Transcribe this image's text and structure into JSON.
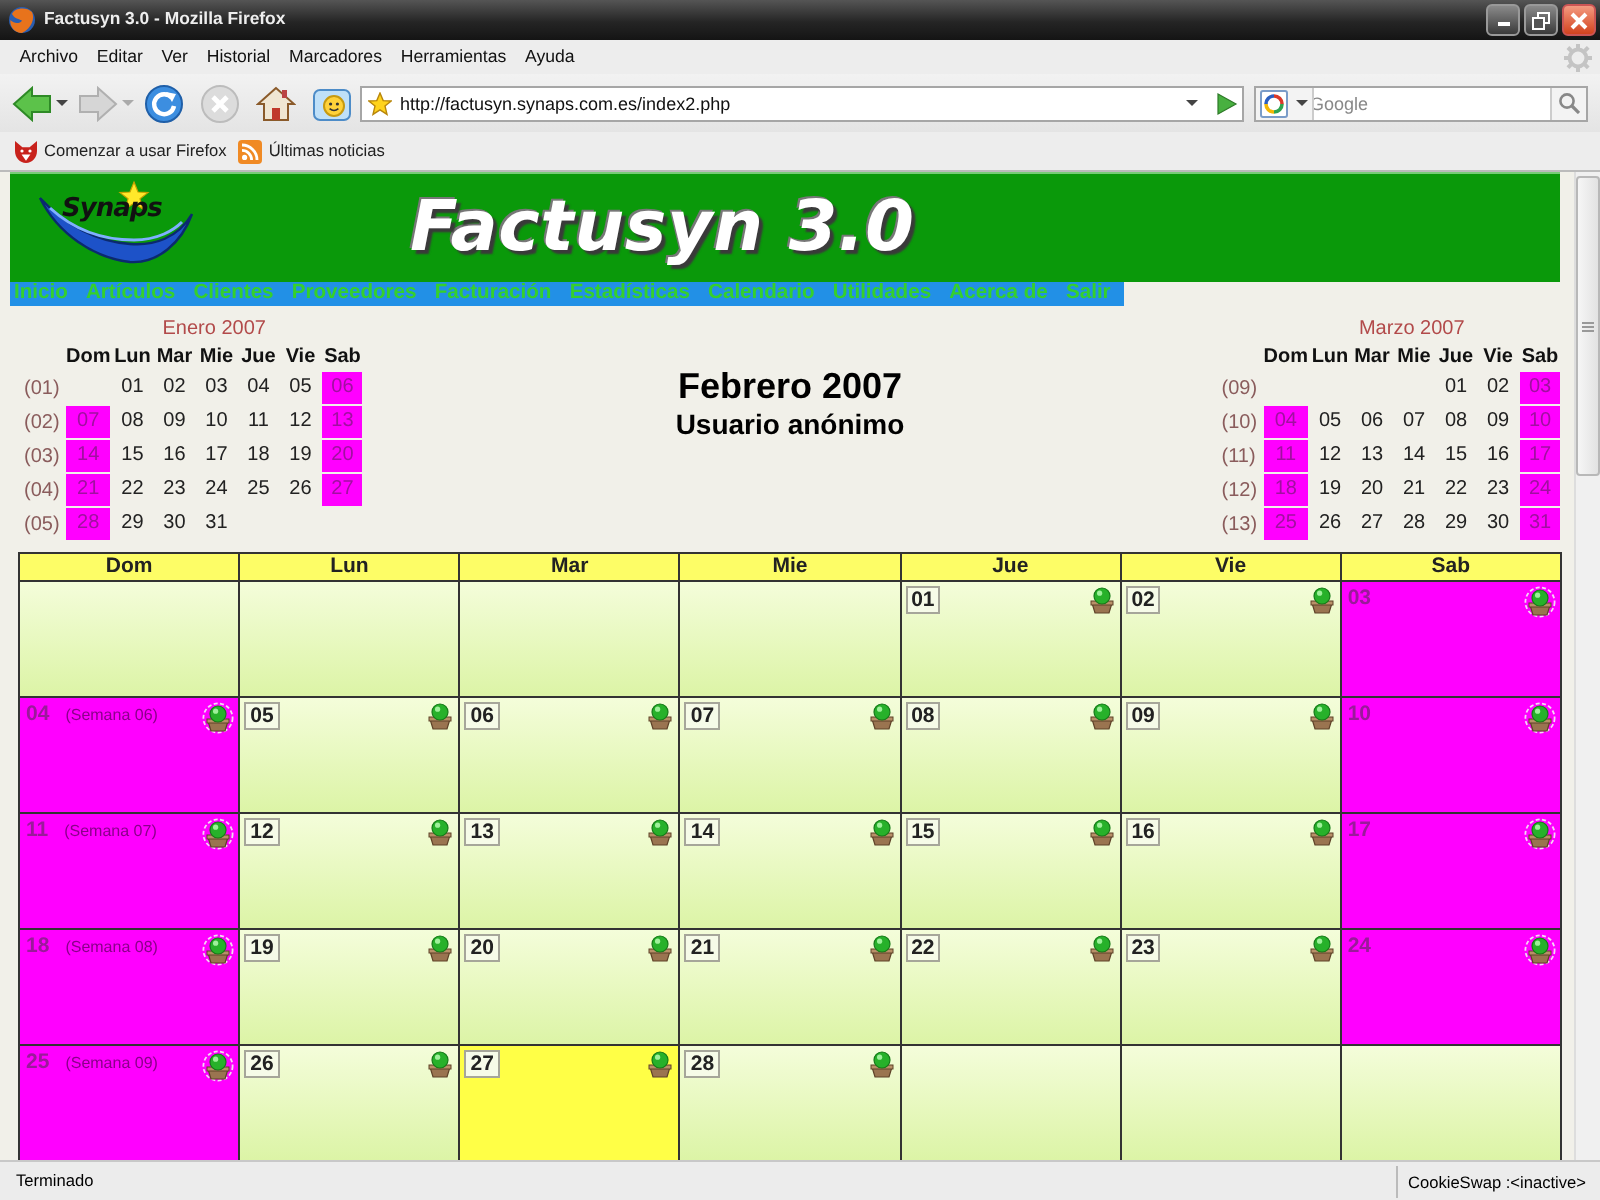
{
  "window": {
    "title": "Factusyn 3.0 - Mozilla Firefox"
  },
  "menu": [
    "Archivo",
    "Editar",
    "Ver",
    "Historial",
    "Marcadores",
    "Herramientas",
    "Ayuda"
  ],
  "address_bar": {
    "url": "http://factusyn.synaps.com.es/index2.php"
  },
  "search_box": {
    "placeholder": "Google"
  },
  "bookmarks": [
    {
      "kind": "bookmark",
      "label": "Comenzar a usar Firefox"
    },
    {
      "kind": "feed",
      "label": "Últimas noticias"
    }
  ],
  "banner": {
    "logo": "Synaps",
    "title": "Factusyn 3.0"
  },
  "nav": [
    "Inicio",
    "Artículos",
    "Clientes",
    "Proveedores",
    "Facturación",
    "Estadísticas",
    "Calendario",
    "Utilidades",
    "Acerca de",
    "Salir"
  ],
  "header": {
    "prev_month": {
      "title": "Enero 2007",
      "weekdays": [
        "Dom",
        "Lun",
        "Mar",
        "Mie",
        "Jue",
        "Vie",
        "Sab"
      ],
      "weeks": [
        {
          "number": "(01)",
          "days": [
            {
              "kind": "blank"
            },
            {
              "kind": "weekday",
              "day": "01"
            },
            {
              "kind": "weekday",
              "day": "02"
            },
            {
              "kind": "weekday",
              "day": "03"
            },
            {
              "kind": "weekday",
              "day": "04"
            },
            {
              "kind": "weekday",
              "day": "05"
            },
            {
              "kind": "weekend",
              "day": "06"
            }
          ]
        },
        {
          "number": "(02)",
          "days": [
            {
              "kind": "weekend",
              "day": "07"
            },
            {
              "kind": "weekday",
              "day": "08"
            },
            {
              "kind": "weekday",
              "day": "09"
            },
            {
              "kind": "weekday",
              "day": "10"
            },
            {
              "kind": "weekday",
              "day": "11"
            },
            {
              "kind": "weekday",
              "day": "12"
            },
            {
              "kind": "weekend",
              "day": "13"
            }
          ]
        },
        {
          "number": "(03)",
          "days": [
            {
              "kind": "weekend",
              "day": "14"
            },
            {
              "kind": "weekday",
              "day": "15"
            },
            {
              "kind": "weekday",
              "day": "16"
            },
            {
              "kind": "weekday",
              "day": "17"
            },
            {
              "kind": "weekday",
              "day": "18"
            },
            {
              "kind": "weekday",
              "day": "19"
            },
            {
              "kind": "weekend",
              "day": "20"
            }
          ]
        },
        {
          "number": "(04)",
          "days": [
            {
              "kind": "weekend",
              "day": "21"
            },
            {
              "kind": "weekday",
              "day": "22"
            },
            {
              "kind": "weekday",
              "day": "23"
            },
            {
              "kind": "weekday",
              "day": "24"
            },
            {
              "kind": "weekday",
              "day": "25"
            },
            {
              "kind": "weekday",
              "day": "26"
            },
            {
              "kind": "weekend",
              "day": "27"
            }
          ]
        },
        {
          "number": "(05)",
          "days": [
            {
              "kind": "weekend",
              "day": "28"
            },
            {
              "kind": "weekday",
              "day": "29"
            },
            {
              "kind": "weekday",
              "day": "30"
            },
            {
              "kind": "weekday",
              "day": "31"
            },
            {
              "kind": "blank"
            },
            {
              "kind": "blank"
            },
            {
              "kind": "blank"
            }
          ]
        }
      ]
    },
    "title": "Febrero 2007",
    "user": "Usuario anónimo",
    "next_month": {
      "title": "Marzo 2007",
      "weekdays": [
        "Dom",
        "Lun",
        "Mar",
        "Mie",
        "Jue",
        "Vie",
        "Sab"
      ],
      "weeks": [
        {
          "number": "(09)",
          "days": [
            {
              "kind": "blank"
            },
            {
              "kind": "blank"
            },
            {
              "kind": "blank"
            },
            {
              "kind": "blank"
            },
            {
              "kind": "weekday",
              "day": "01"
            },
            {
              "kind": "weekday",
              "day": "02"
            },
            {
              "kind": "weekend",
              "day": "03"
            }
          ]
        },
        {
          "number": "(10)",
          "days": [
            {
              "kind": "weekend",
              "day": "04"
            },
            {
              "kind": "weekday",
              "day": "05"
            },
            {
              "kind": "weekday",
              "day": "06"
            },
            {
              "kind": "weekday",
              "day": "07"
            },
            {
              "kind": "weekday",
              "day": "08"
            },
            {
              "kind": "weekday",
              "day": "09"
            },
            {
              "kind": "weekend",
              "day": "10"
            }
          ]
        },
        {
          "number": "(11)",
          "days": [
            {
              "kind": "weekend",
              "day": "11"
            },
            {
              "kind": "weekday",
              "day": "12"
            },
            {
              "kind": "weekday",
              "day": "13"
            },
            {
              "kind": "weekday",
              "day": "14"
            },
            {
              "kind": "weekday",
              "day": "15"
            },
            {
              "kind": "weekday",
              "day": "16"
            },
            {
              "kind": "weekend",
              "day": "17"
            }
          ]
        },
        {
          "number": "(12)",
          "days": [
            {
              "kind": "weekend",
              "day": "18"
            },
            {
              "kind": "weekday",
              "day": "19"
            },
            {
              "kind": "weekday",
              "day": "20"
            },
            {
              "kind": "weekday",
              "day": "21"
            },
            {
              "kind": "weekday",
              "day": "22"
            },
            {
              "kind": "weekday",
              "day": "23"
            },
            {
              "kind": "weekend",
              "day": "24"
            }
          ]
        },
        {
          "number": "(13)",
          "days": [
            {
              "kind": "weekend",
              "day": "25"
            },
            {
              "kind": "weekday",
              "day": "26"
            },
            {
              "kind": "weekday",
              "day": "27"
            },
            {
              "kind": "weekday",
              "day": "28"
            },
            {
              "kind": "weekday",
              "day": "29"
            },
            {
              "kind": "weekday",
              "day": "30"
            },
            {
              "kind": "weekend",
              "day": "31"
            }
          ]
        }
      ]
    }
  },
  "calendar": {
    "columns": [
      "Dom",
      "Lun",
      "Mar",
      "Mie",
      "Jue",
      "Vie",
      "Sab"
    ],
    "weeks": [
      {
        "days": [
          {
            "kind": "blank"
          },
          {
            "kind": "blank"
          },
          {
            "kind": "blank"
          },
          {
            "kind": "blank"
          },
          {
            "kind": "weekday",
            "day": "01"
          },
          {
            "kind": "weekday",
            "day": "02"
          },
          {
            "kind": "weekend",
            "day": "03"
          }
        ]
      },
      {
        "days": [
          {
            "kind": "weekend",
            "day": "04",
            "week_label": "(Semana 06)"
          },
          {
            "kind": "weekday",
            "day": "05"
          },
          {
            "kind": "weekday",
            "day": "06"
          },
          {
            "kind": "weekday",
            "day": "07"
          },
          {
            "kind": "weekday",
            "day": "08"
          },
          {
            "kind": "weekday",
            "day": "09"
          },
          {
            "kind": "weekend",
            "day": "10"
          }
        ]
      },
      {
        "days": [
          {
            "kind": "weekend",
            "day": "11",
            "week_label": "(Semana 07)"
          },
          {
            "kind": "weekday",
            "day": "12"
          },
          {
            "kind": "weekday",
            "day": "13"
          },
          {
            "kind": "weekday",
            "day": "14"
          },
          {
            "kind": "weekday",
            "day": "15"
          },
          {
            "kind": "weekday",
            "day": "16"
          },
          {
            "kind": "weekend",
            "day": "17"
          }
        ]
      },
      {
        "days": [
          {
            "kind": "weekend",
            "day": "18",
            "week_label": "(Semana 08)"
          },
          {
            "kind": "weekday",
            "day": "19"
          },
          {
            "kind": "weekday",
            "day": "20"
          },
          {
            "kind": "weekday",
            "day": "21"
          },
          {
            "kind": "weekday",
            "day": "22"
          },
          {
            "kind": "weekday",
            "day": "23"
          },
          {
            "kind": "weekend",
            "day": "24"
          }
        ]
      },
      {
        "days": [
          {
            "kind": "weekend",
            "day": "25",
            "week_label": "(Semana 09)"
          },
          {
            "kind": "weekday",
            "day": "26"
          },
          {
            "kind": "today",
            "day": "27"
          },
          {
            "kind": "weekday",
            "day": "28"
          },
          {
            "kind": "blank"
          },
          {
            "kind": "blank"
          },
          {
            "kind": "blank"
          }
        ]
      }
    ]
  },
  "status_bar": {
    "text": "Terminado",
    "extension": "CookieSwap :<inactive>"
  }
}
